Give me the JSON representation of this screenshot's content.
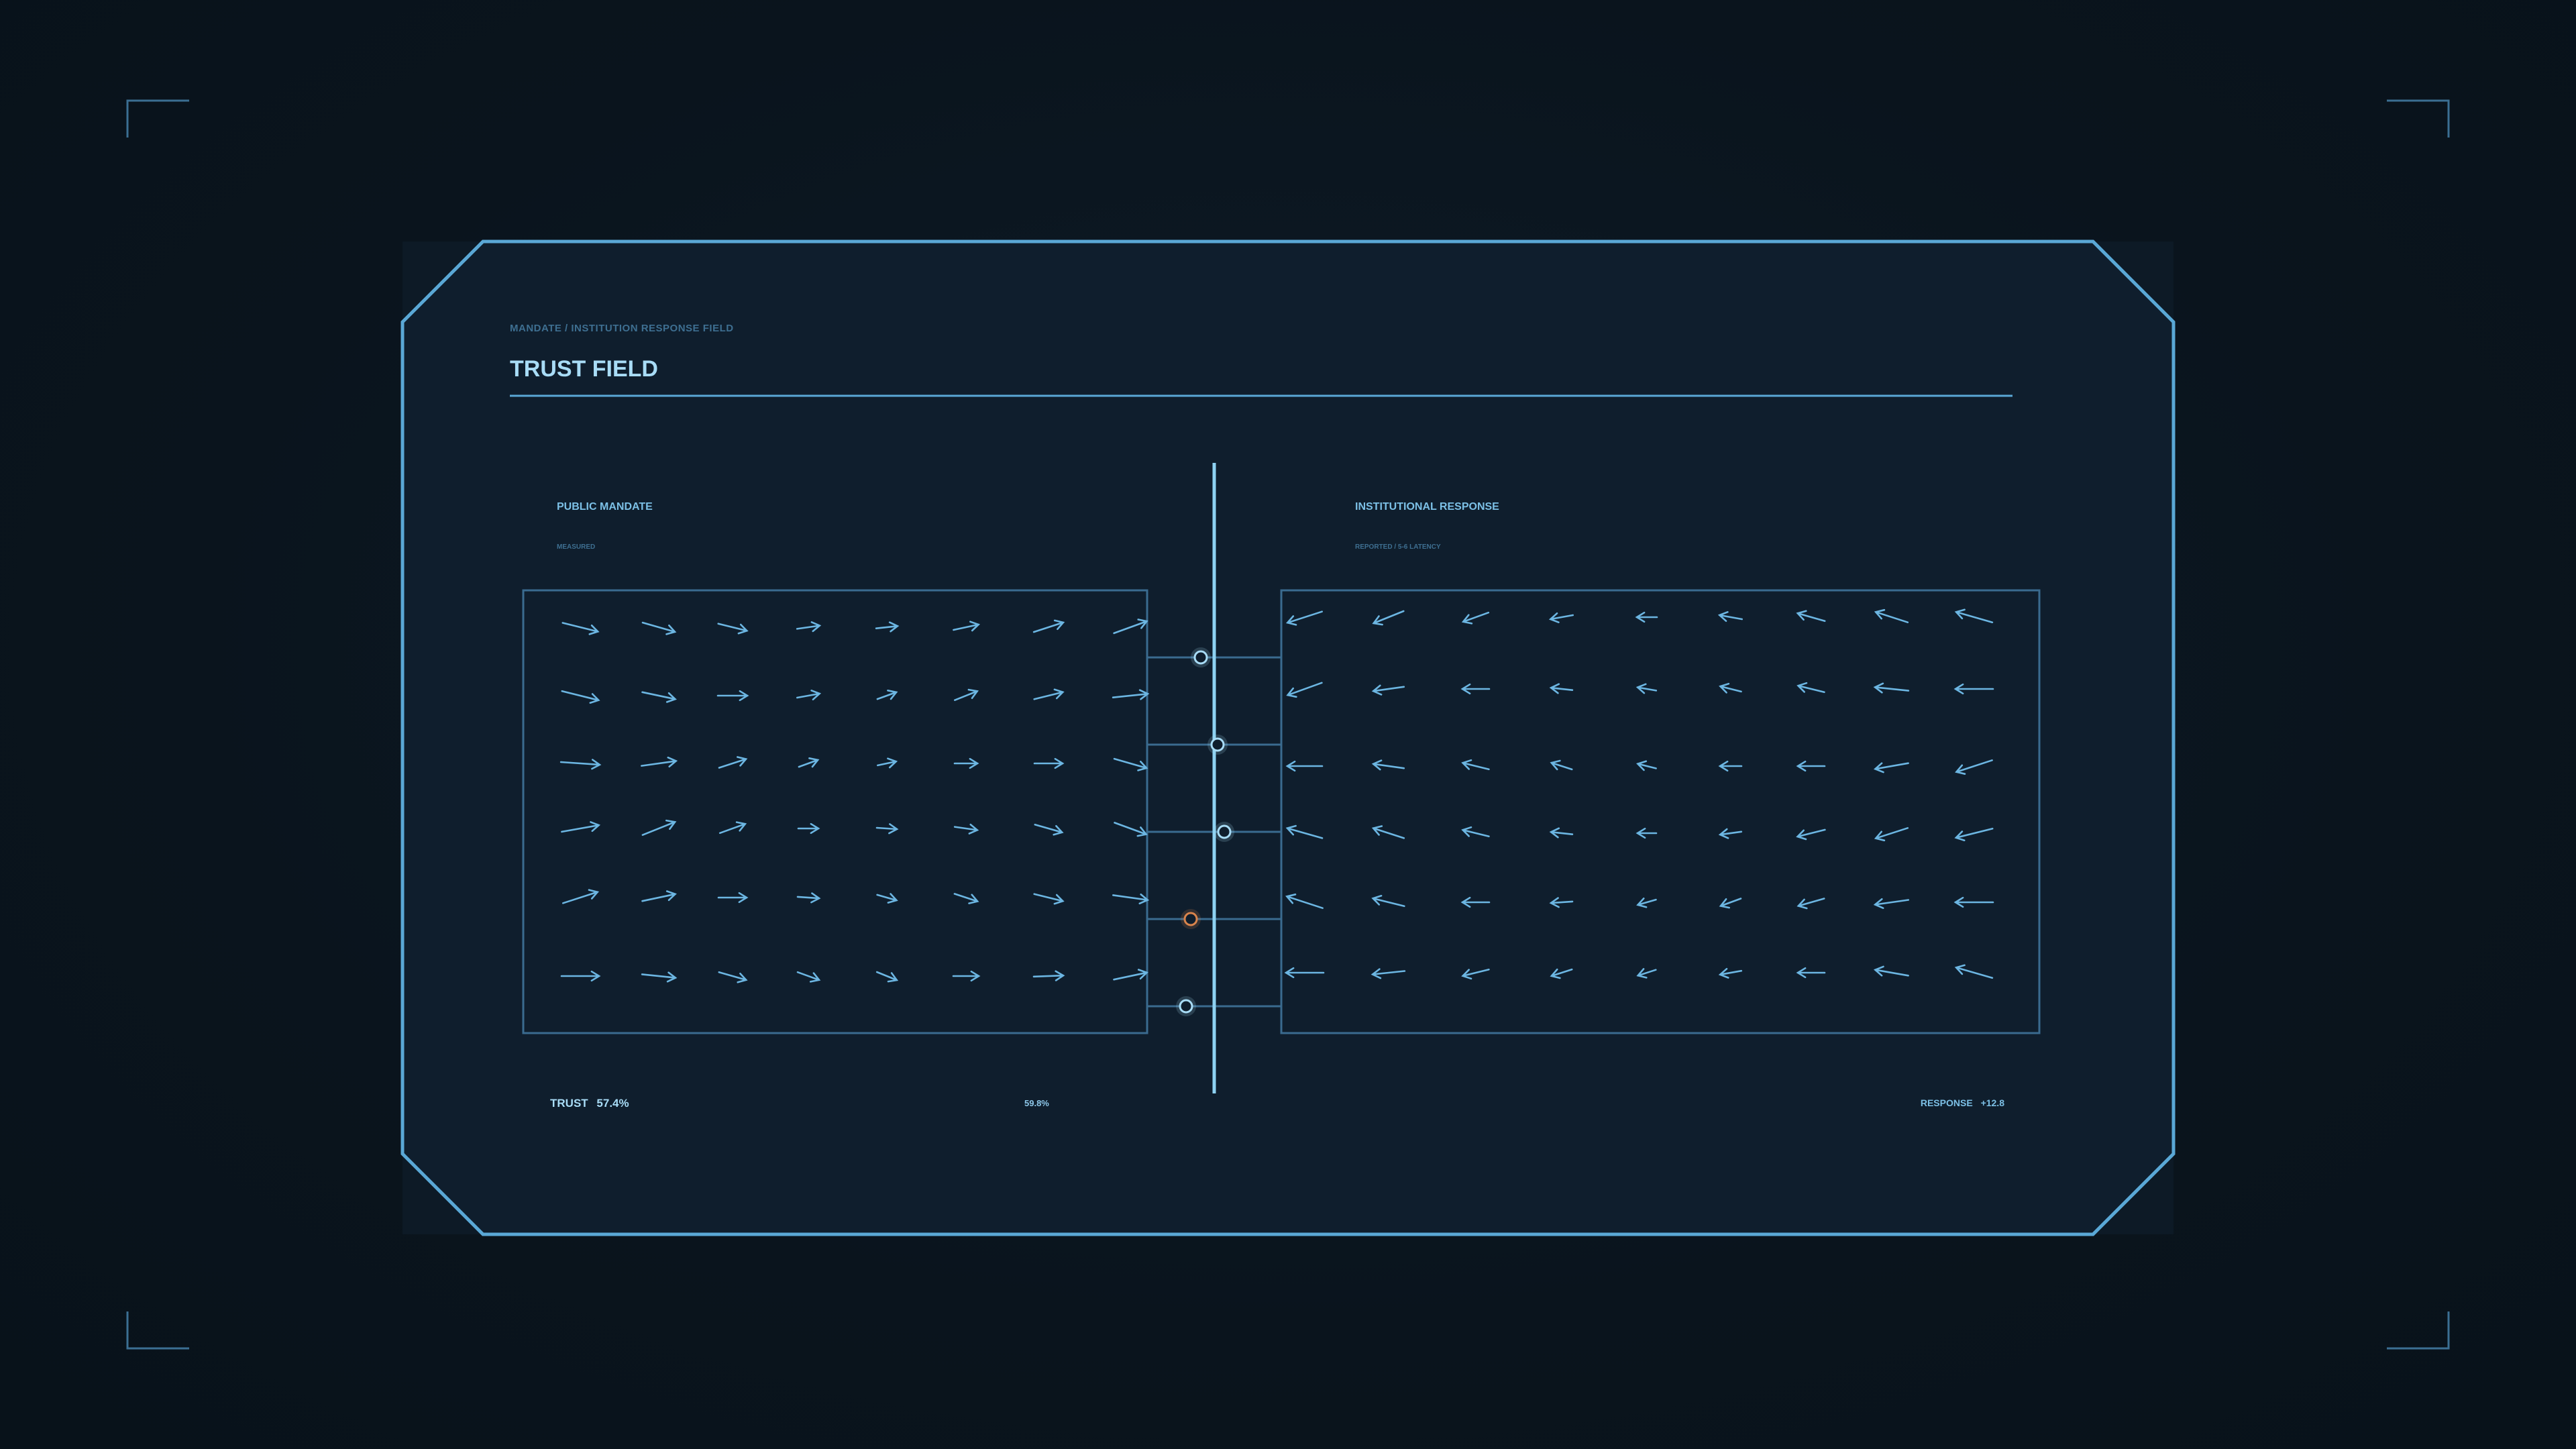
{
  "panel": {
    "eyebrow": "MANDATE / INSTITUTION RESPONSE FIELD",
    "title": "TRUST FIELD"
  },
  "left_field": {
    "label": "PUBLIC MANDATE",
    "sublabel": "MEASURED"
  },
  "right_field": {
    "label": "INSTITUTIONAL RESPONSE",
    "sublabel": "REPORTED / 5-6 LATENCY"
  },
  "footer": {
    "trust_label": "TRUST",
    "trust_value": "57.4%",
    "mid_value": "59.8%",
    "response_label": "RESPONSE",
    "response_value": "+12.8"
  },
  "channel_nodes": [
    {
      "offset": -0.2,
      "status": "normal"
    },
    {
      "offset": 0.05,
      "status": "normal"
    },
    {
      "offset": 0.15,
      "status": "normal"
    },
    {
      "offset": -0.35,
      "status": "alert"
    },
    {
      "offset": -0.42,
      "status": "normal"
    }
  ],
  "colors": {
    "background": "#0a141d",
    "panel_fill": "#0f1e2d",
    "accent": "#6cb6e2",
    "accent_bright": "#a8dcf6",
    "frame": "#4f9cc8",
    "muted": "#3e6f91",
    "box_stroke": "#3a6b8f",
    "alert": "#d9844c"
  }
}
